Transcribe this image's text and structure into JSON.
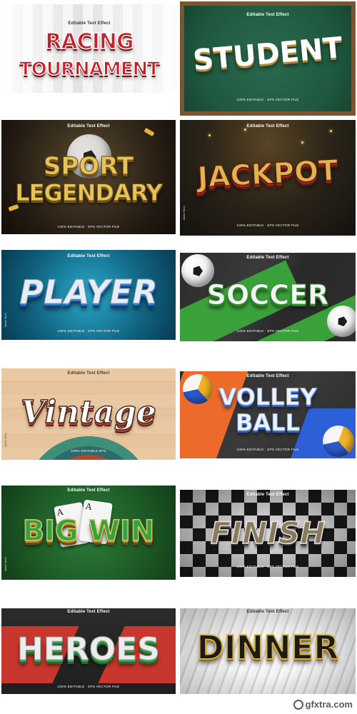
{
  "tiles": [
    {
      "id": "t1",
      "header": "Editable Text Effect",
      "sub": "",
      "title_lines": [
        "RACING",
        "TOURNAMENT"
      ],
      "footer": "",
      "side": ""
    },
    {
      "id": "t2",
      "header": "Editable Text Effect",
      "sub": "",
      "title_lines": [
        "STUDENT"
      ],
      "footer": "100% EDITABLE · EPS VECTOR FILE",
      "side": ""
    },
    {
      "id": "t3",
      "header": "Editable Text Effect",
      "sub": "",
      "title_lines": [
        "SPORT",
        "LEGENDARY"
      ],
      "footer": "100% EDITABLE · EPS VECTOR FILE",
      "side": ""
    },
    {
      "id": "t4",
      "header": "Editable Text Effect",
      "sub": "",
      "title_lines": [
        "JACKPOT"
      ],
      "footer": "100% EDITABLE · EPS VECTOR FILE",
      "side": "Adobe Stock"
    },
    {
      "id": "t5",
      "header": "Editable Text Effect",
      "sub": "",
      "title_lines": [
        "PLAYER"
      ],
      "footer": "100% EDITABLE · EPS VECTOR FILE",
      "side": "Adobe Stock"
    },
    {
      "id": "t6",
      "header": "Editable Text Effect",
      "sub": "",
      "title_lines": [
        "SOCCER"
      ],
      "footer": "100% EDITABLE · EPS VECTOR FILE",
      "side": ""
    },
    {
      "id": "t7",
      "header": "Editable Text Effect",
      "sub": "",
      "title_lines": [
        "Vintage"
      ],
      "footer": "100% EDITABLE EPS",
      "side": "Adobe Stock"
    },
    {
      "id": "t8",
      "header": "Editable Text Effect",
      "sub": "",
      "title_lines": [
        "VOLLEY",
        "BALL"
      ],
      "footer": "100% EDITABLE · EPS VECTOR FILE",
      "side": ""
    },
    {
      "id": "t9",
      "header": "Editable Text Effect",
      "sub": "",
      "title_lines": [
        "BIG WIN"
      ],
      "footer": "",
      "side": "Adobe Stock"
    },
    {
      "id": "t10",
      "header": "Editable Text Effect",
      "sub": "",
      "title_lines": [
        "FINISH"
      ],
      "footer": "100% EDITABLE · EPS VECTOR FILE",
      "side": ""
    },
    {
      "id": "t11",
      "header": "Editable Text Effect",
      "sub": "",
      "title_lines": [
        "HEROES"
      ],
      "footer": "100% EDITABLE · EPS VECTOR FILE",
      "side": ""
    },
    {
      "id": "t12",
      "header": "Editable Text Effect",
      "sub": "",
      "title_lines": [
        "DINNER"
      ],
      "footer": "",
      "side": ""
    }
  ],
  "cards": {
    "suit_label": "A"
  },
  "watermark": {
    "text": "gfxtra.com"
  },
  "colors": {
    "racing": "#c8202a",
    "student": "#ffffff",
    "gold": "#d9b143",
    "player": "#dfe9f2",
    "soccer": "#f2f2f2",
    "vintage": "#ffffff",
    "bigwin": "#2fa545",
    "finish": "#8a7a5c",
    "heroes": "#e8e8e8",
    "dinner": "#1b1b1b"
  }
}
